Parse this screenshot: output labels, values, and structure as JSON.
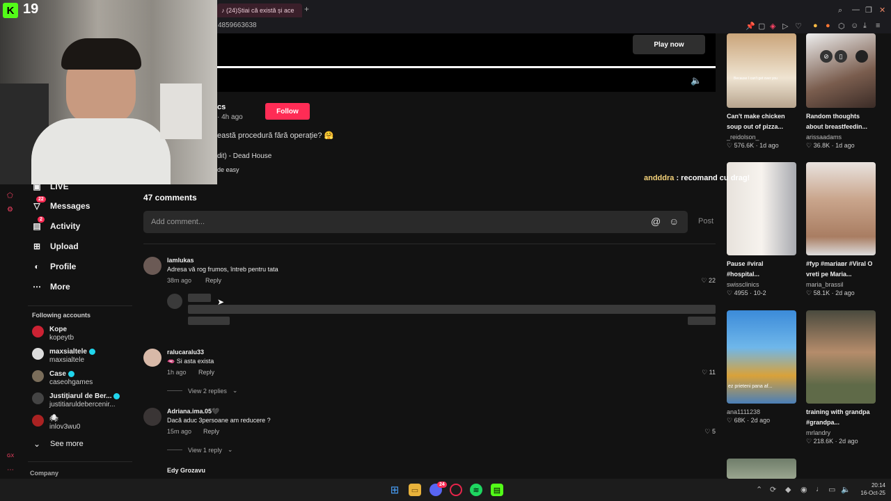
{
  "browser": {
    "tab_title": "(24)Știai că există și ace",
    "new_tab": "+",
    "url_fragment": "4859663638",
    "close": "✕"
  },
  "video": {
    "play_now": "Play now"
  },
  "post": {
    "author_fragment": "cs",
    "time": "· 4h ago",
    "follow_label": "Follow",
    "caption": "eastă procedură fără operație? 🤗",
    "music": "dit) - Dead House",
    "tag_line": "de easy"
  },
  "sidebar": {
    "live": "LIVE",
    "messages": "Messages",
    "messages_badge": "22",
    "activity": "Activity",
    "activity_badge": "2",
    "upload": "Upload",
    "profile": "Profile",
    "more": "More",
    "following_title": "Following accounts",
    "see_more": "See more",
    "company": "Company",
    "accounts": [
      {
        "name": "Kope",
        "user": "kopeytb",
        "verified": false
      },
      {
        "name": "maxsialtele",
        "user": "maxsialtele",
        "verified": true
      },
      {
        "name": "Case",
        "user": "caseohgames",
        "verified": true
      },
      {
        "name": "Justițiarul de Ber...",
        "user": "justitiaruldebercenir...",
        "verified": true
      },
      {
        "name": "🕷",
        "user": "inlov3wu0",
        "verified": false
      }
    ]
  },
  "comments": {
    "count_label": "47 comments",
    "input_placeholder": "Add comment...",
    "post_label": "Post",
    "reply_label": "Reply",
    "items": [
      {
        "name": "Iamlukas",
        "text": "Adresa vă rog frumos, întreb pentru tata",
        "time": "38m ago",
        "likes": "22"
      },
      {
        "name": "ralucaralu33",
        "text": "🫦 Si asta exista",
        "time": "1h ago",
        "likes": "11",
        "view_replies": "View 2 replies"
      },
      {
        "name": "Adriana.ima.05🖤",
        "text": "Dacă aduc 3persoane am reducere ?",
        "time": "15m ago",
        "likes": "5",
        "view_replies": "View 1 reply"
      },
      {
        "name": "Edy Grozavu",
        "text": ""
      }
    ]
  },
  "right_videos": [
    {
      "title": "Can't make chicken soup out of pizza...",
      "user": "_reidolson_",
      "stats": "♡ 576.6K · 1d ago",
      "caption": "Because I can't get over you"
    },
    {
      "title": "Random thoughts about breastfeedin...",
      "user": "arissaadams",
      "stats": "♡ 36.8K · 1d ago"
    },
    {
      "title": "Pause #viral #hospital...",
      "user": "swissclinics",
      "stats": "♡ 4955 · 10-2"
    },
    {
      "title": "#fyp #mariавr #Viral O vreti pe Maria...",
      "user": "maria_brassil",
      "stats": "♡ 58.1K · 2d ago"
    },
    {
      "title": "",
      "user": "ana1111238",
      "stats": "♡ 68K · 2d ago",
      "caption": "ez prieteni pana af..."
    },
    {
      "title": "training with grandpa #grandpa...",
      "user": "mrlandry",
      "stats": "♡ 218.6K · 2d ago"
    }
  ],
  "stream": {
    "kick_count": "19",
    "chat_user": "andddra",
    "chat_msg": " : recomand cu drag!"
  },
  "taskbar": {
    "time": "20:14",
    "date": "16-Oct-25",
    "discord_badge": "24"
  },
  "gx": {
    "label": "GX"
  }
}
